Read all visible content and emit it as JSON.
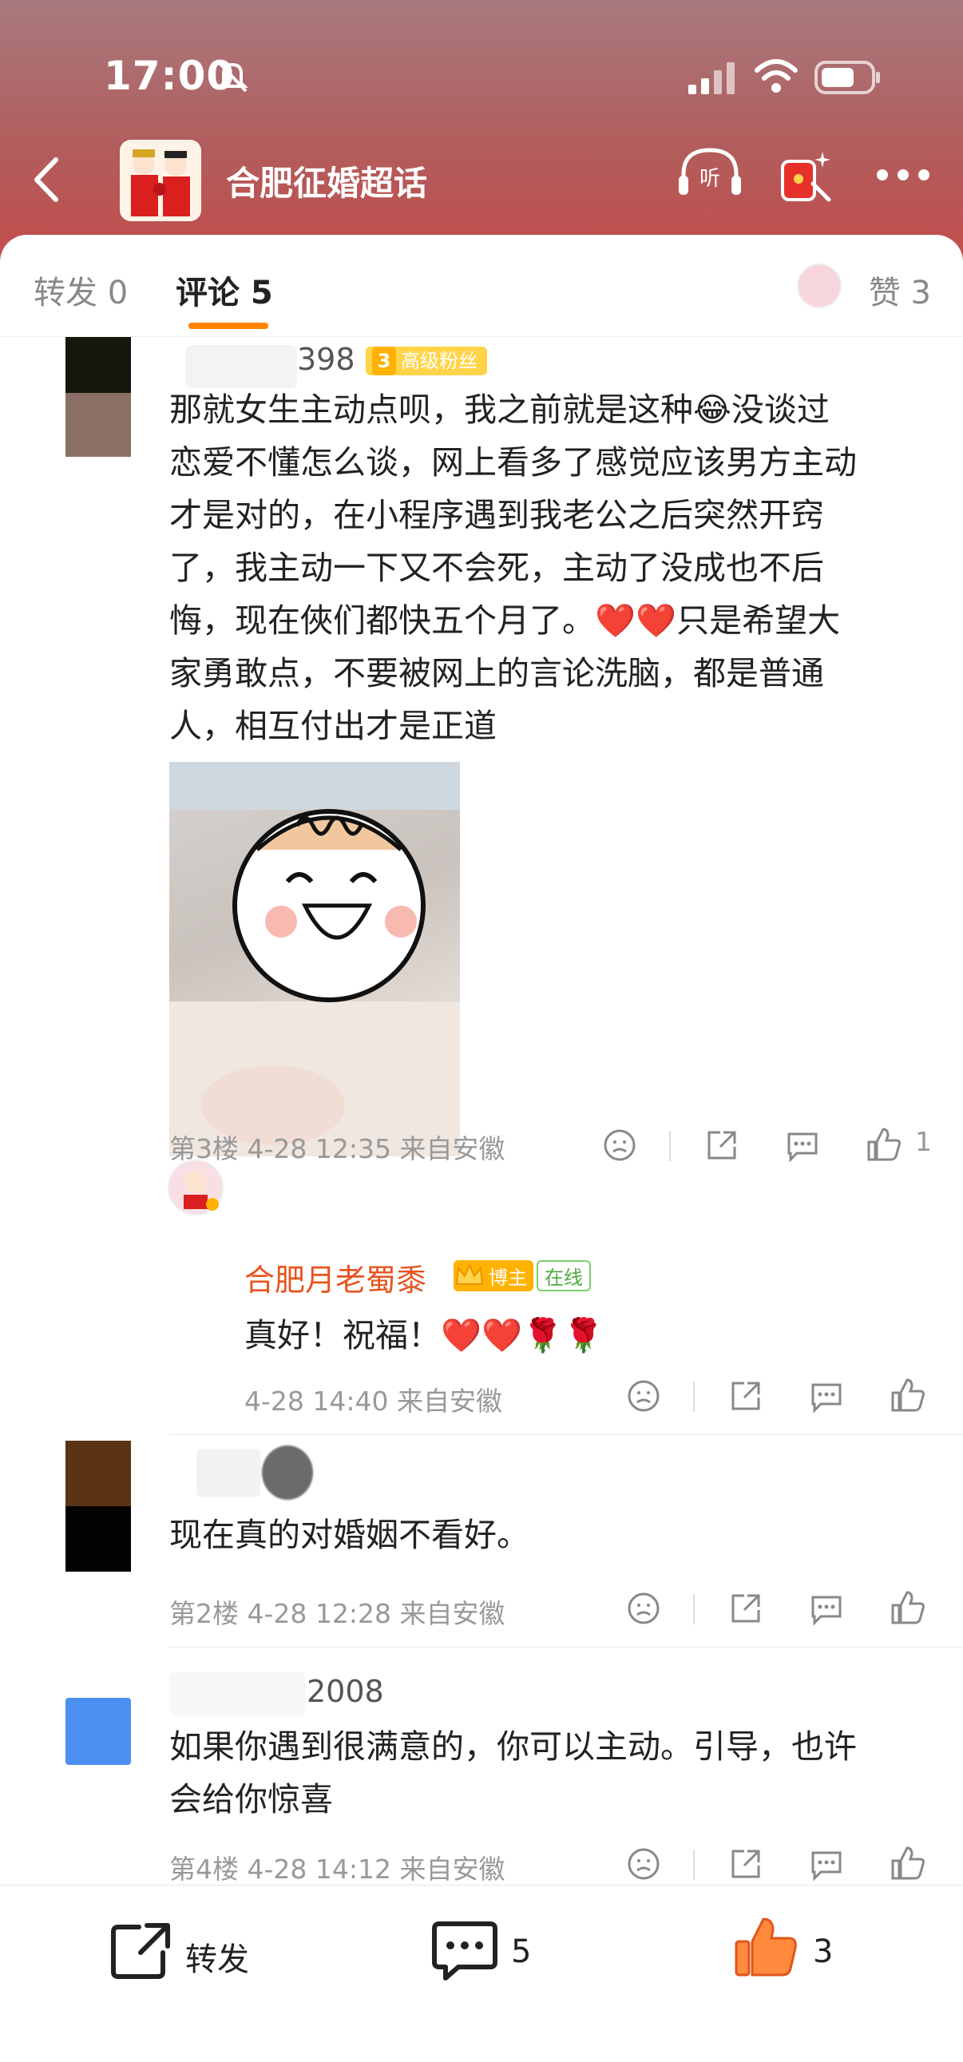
{
  "status": {
    "time": "17:00"
  },
  "header": {
    "topic_title": "合肥征婚超话",
    "listen_label": "听"
  },
  "tabs": {
    "repost": "转发 0",
    "comment": "评论 5",
    "likes": "赞 3"
  },
  "comments": [
    {
      "author": "398",
      "fan_level": "3",
      "fan_badge": "高级粉丝",
      "text_lines": [
        "那就女生主动点呗，我之前就是这种😂没谈过",
        "恋爱不懂怎么谈，网上看多了感觉应该男方主动",
        "才是对的，在小程序遇到我老公之后突然开窍",
        "了，我主动一下又不会死，主动了没成也不后",
        "悔，现在俠们都快五个月了。❤️❤️只是希望大",
        "家勇敢点，不要被网上的言论洗脑，都是普通",
        "人，相互付出才是正道"
      ],
      "meta": "第3楼 4-28 12:35 来自安徽",
      "like_count": "1",
      "reply": {
        "author": "合肥月老蜀黍",
        "host_badge": "博主",
        "online_badge": "在线",
        "text": "真好！祝福！❤️❤️🌹🌹",
        "meta": "4-28 14:40 来自安徽"
      }
    },
    {
      "author": "",
      "text": "现在真的对婚姻不看好。",
      "meta": "第2楼 4-28 12:28 来自安徽"
    },
    {
      "author": "2008",
      "text_lines": [
        "如果你遇到很满意的，你可以主动。引导，也许",
        "会给你惊喜"
      ],
      "meta": "第4楼 4-28 14:12 来自安徽"
    }
  ],
  "bottombar": {
    "repost_label": "转发",
    "comment_count": "5",
    "like_count": "3"
  },
  "colors": {
    "accent": "#ff8200",
    "host_name": "#e8541e",
    "header_bg": "#b25d5d"
  }
}
